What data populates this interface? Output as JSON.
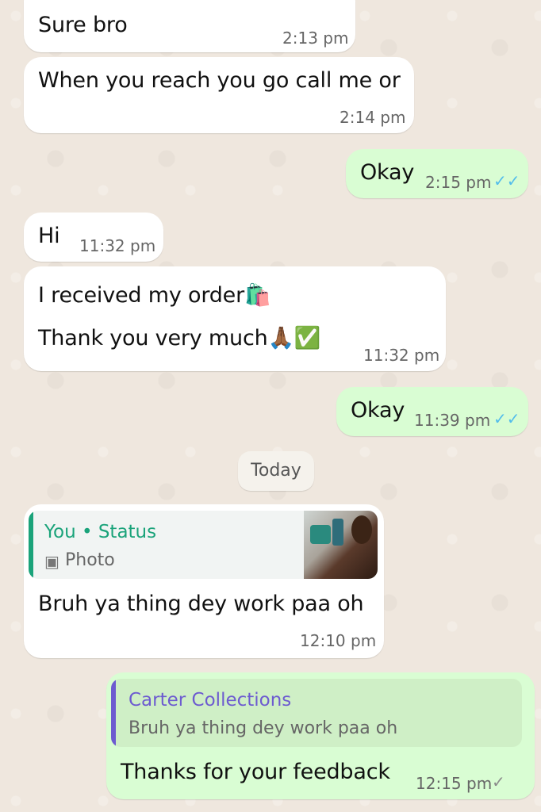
{
  "messages": [
    {
      "text": "Sure bro",
      "time": "2:13 pm"
    },
    {
      "text": "When you reach you go call me or",
      "time": "2:14 pm"
    },
    {
      "text": "Okay",
      "time": "2:15 pm",
      "status": "read"
    },
    {
      "text": "Hi",
      "time": "11:32 pm"
    },
    {
      "line1": "I received my order🛍️",
      "line2": "Thank you very much🙏🏾✅",
      "time": "11:32 pm"
    },
    {
      "text": "Okay",
      "time": "11:39 pm",
      "status": "read"
    },
    {
      "quote_author": "You • Status",
      "quote_type": "Photo",
      "text": "Bruh ya thing dey work paa oh",
      "time": "12:10 pm"
    },
    {
      "quote_author": "Carter Collections",
      "quote_text": "Bruh ya thing dey work paa oh",
      "text": "Thanks for your feedback",
      "time": "12:15 pm",
      "status": "sent"
    }
  ],
  "date_separator": "Today",
  "icons": {
    "read": "✓✓",
    "sent": "✓",
    "photo": "▣"
  },
  "colors": {
    "incoming_bubble": "#ffffff",
    "outgoing_bubble": "#d9fdd3",
    "read_tick": "#53bdeb",
    "status_quote_bar": "#1aa37a",
    "reply_quote_bar": "#6d5bd0"
  }
}
